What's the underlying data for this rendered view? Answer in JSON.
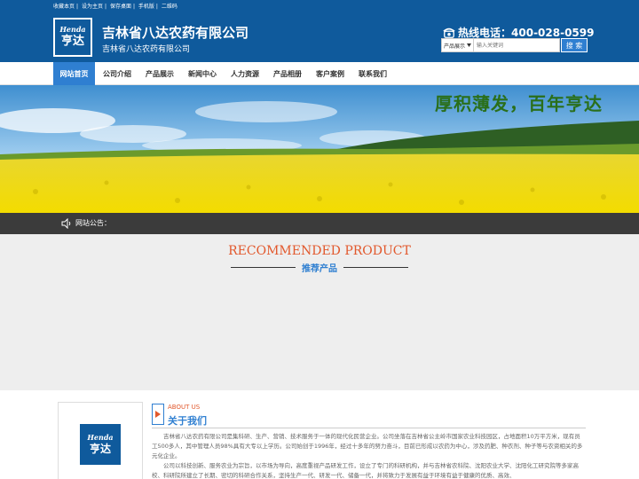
{
  "header": {
    "top_links": [
      "收藏本页",
      "设为主页",
      "保存桌面",
      "手机版",
      "二维码"
    ],
    "top_link_separator": "|",
    "logo_en": "Henda",
    "logo_cn": "亨达",
    "company_name": "吉林省八达农药有限公司",
    "company_subtitle": "吉林省八达农药有限公司",
    "hotline_label": "热线电话：",
    "hotline_number": "400-028-0599",
    "search": {
      "category": "产品展示",
      "placeholder": "输入关键词",
      "button": "搜 索"
    }
  },
  "nav": {
    "items": [
      "网站首页",
      "公司介绍",
      "产品展示",
      "新闻中心",
      "人力资源",
      "产品相册",
      "客户案例",
      "联系我们"
    ],
    "active": "网站首页"
  },
  "banner": {
    "slogan": "厚积薄发，百年亨达"
  },
  "notice": {
    "label": "网站公告："
  },
  "recommend": {
    "title_en": "RECOMMENDED PRODUCT",
    "title_cn": "推荐产品"
  },
  "about": {
    "logo_en": "Henda",
    "logo_cn": "亨达",
    "title_en": "ABOUT US",
    "title_cn": "关于我们",
    "paragraphs": [
      "吉林省八达农药有限公司是集科研、生产、营销、技术服务于一体的现代化民营企业。公司坐落在吉林省公主岭市国家农业科技园区，占地面积10万平方米，现有员工500多人，其中管理人员98%具有大专以上学历。公司始创于1996年，经过十多年的努力奋斗，目前已形成以农药为中心，涉及药肥、种衣剂、种子等与农资相关的多元化企业。",
      "公司以科技创新、服务农业为宗旨，以市场为导向，高度重视产品研发工作，设立了专门的科研机构，并与吉林省农科院、沈阳农业大学、沈阳化工研究院等多家高校、科研院所建立了长期、密切的科研合作关系，坚持生产一代、研发一代、储备一代，并将致力于发展有益于环境有益于健康的优质、高效、"
    ]
  },
  "colors": {
    "header_blue": "#0f5a9c",
    "accent_blue": "#2f7fd1",
    "accent_orange": "#e2582c",
    "notice_bg": "#3b3b3b",
    "section_bg": "#eeeeee"
  },
  "icons": [
    "phone-icon",
    "speaker-icon",
    "dropdown-arrow-icon",
    "arrow-right-icon"
  ]
}
